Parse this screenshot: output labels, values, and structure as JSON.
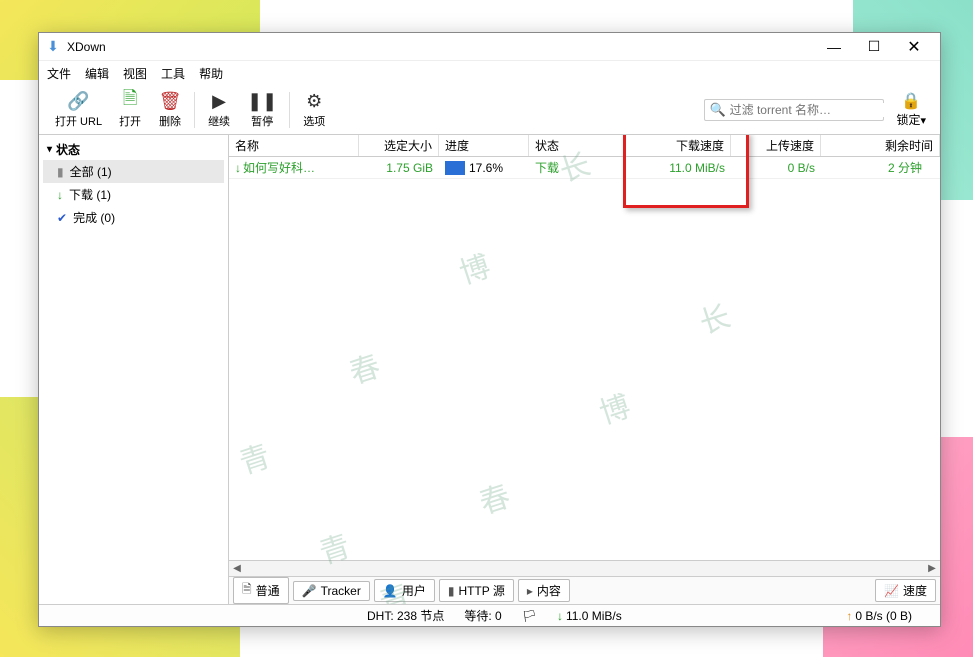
{
  "window": {
    "title": "XDown"
  },
  "menu": {
    "file": "文件",
    "edit": "编辑",
    "view": "视图",
    "tools": "工具",
    "help": "帮助"
  },
  "toolbar": {
    "open_url": "打开 URL",
    "open": "打开",
    "delete": "删除",
    "resume": "继续",
    "pause": "暂停",
    "options": "选项",
    "search_placeholder": "过滤 torrent 名称…",
    "lock": "锁定"
  },
  "sidebar": {
    "status_header": "状态",
    "items": [
      {
        "label": "全部 (1)"
      },
      {
        "label": "下载 (1)"
      },
      {
        "label": "完成 (0)"
      }
    ]
  },
  "columns": {
    "name": "名称",
    "size": "选定大小",
    "progress": "进度",
    "status": "状态",
    "dspeed": "下载速度",
    "uspeed": "上传速度",
    "remaining": "剩余时间"
  },
  "rows": [
    {
      "name": "如何写好科…",
      "size": "1.75 GiB",
      "progress": "17.6%",
      "status": "下载",
      "dspeed": "11.0 MiB/s",
      "uspeed": "0 B/s",
      "remaining": "2 分钟"
    }
  ],
  "tabs": {
    "general": "普通",
    "tracker": "Tracker",
    "peers": "用户",
    "http": "HTTP 源",
    "content": "内容",
    "speed": "速度"
  },
  "statusbar": {
    "dht": "DHT: 238 节点",
    "wait": "等待: 0",
    "down": "11.0 MiB/s",
    "up": "0 B/s (0 B)"
  },
  "watermarks": {
    "w1": "长",
    "w2": "博",
    "w3": "春",
    "w4": "青"
  }
}
